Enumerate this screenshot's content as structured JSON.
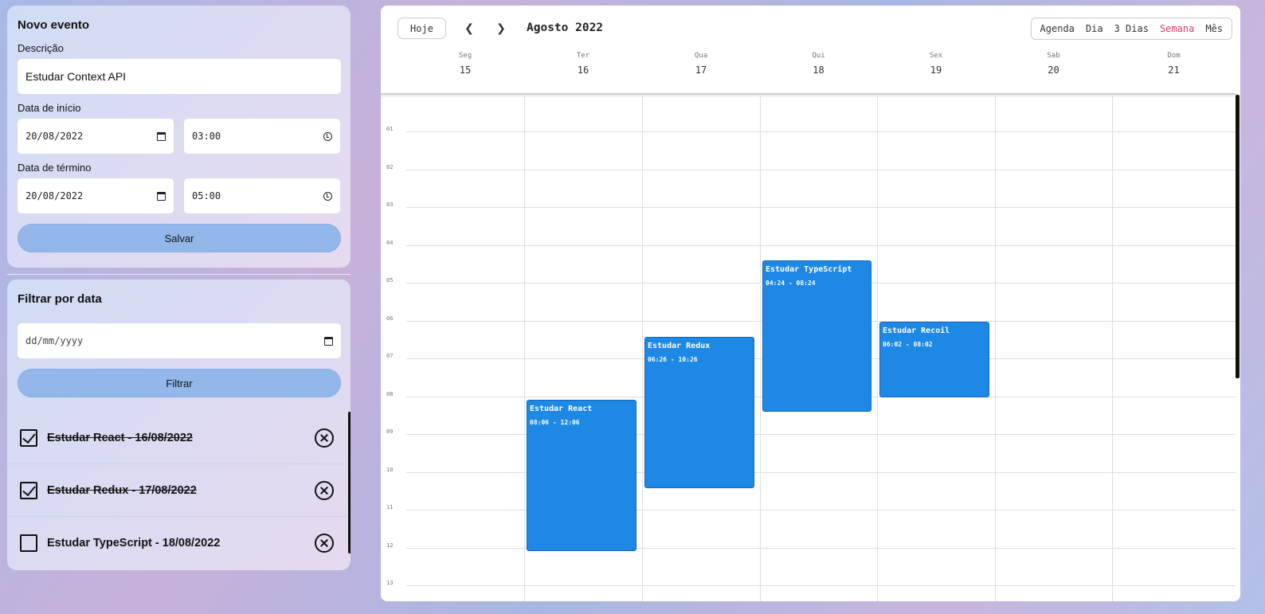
{
  "form": {
    "title": "Novo evento",
    "description_label": "Descrição",
    "description_value": "Estudar Context API",
    "start_label": "Data de início",
    "start_date": "20/08/2022",
    "start_time": "03:00",
    "end_label": "Data de término",
    "end_date": "20/08/2022",
    "end_time": "05:00",
    "save_label": "Salvar"
  },
  "filter": {
    "title": "Filtrar por data",
    "date_placeholder": "dd/mm/yyyy",
    "filter_label": "Filtrar"
  },
  "todos": [
    {
      "text": "Estudar React - 16/08/2022",
      "done": true
    },
    {
      "text": "Estudar Redux - 17/08/2022",
      "done": true
    },
    {
      "text": "Estudar TypeScript - 18/08/2022",
      "done": false
    }
  ],
  "calendar": {
    "today_label": "Hoje",
    "prev_icon": "chevron-left-icon",
    "next_icon": "chevron-right-icon",
    "month_title": "Agosto 2022",
    "views": [
      "Agenda",
      "Dia",
      "3 Dias",
      "Semana",
      "Mês"
    ],
    "active_view": "Semana",
    "accent_color": "#e03c6b",
    "event_color": "#1e88e5",
    "days": [
      {
        "name": "Seg",
        "num": "15"
      },
      {
        "name": "Ter",
        "num": "16"
      },
      {
        "name": "Qua",
        "num": "17"
      },
      {
        "name": "Qui",
        "num": "18"
      },
      {
        "name": "Sex",
        "num": "19"
      },
      {
        "name": "Sab",
        "num": "20"
      },
      {
        "name": "Dom",
        "num": "21"
      }
    ],
    "hours": [
      "01",
      "02",
      "03",
      "04",
      "05",
      "06",
      "07",
      "08",
      "09",
      "10",
      "11",
      "12",
      "13"
    ],
    "events": [
      {
        "title": "Estudar React",
        "time": "08:06 - 12:06",
        "day_index": 1
      },
      {
        "title": "Estudar Redux",
        "time": "06:26 - 10:26",
        "day_index": 2
      },
      {
        "title": "Estudar TypeScript",
        "time": "04:24 - 08:24",
        "day_index": 3
      },
      {
        "title": "Estudar Recoil",
        "time": "06:02 - 08:02",
        "day_index": 4
      }
    ]
  }
}
